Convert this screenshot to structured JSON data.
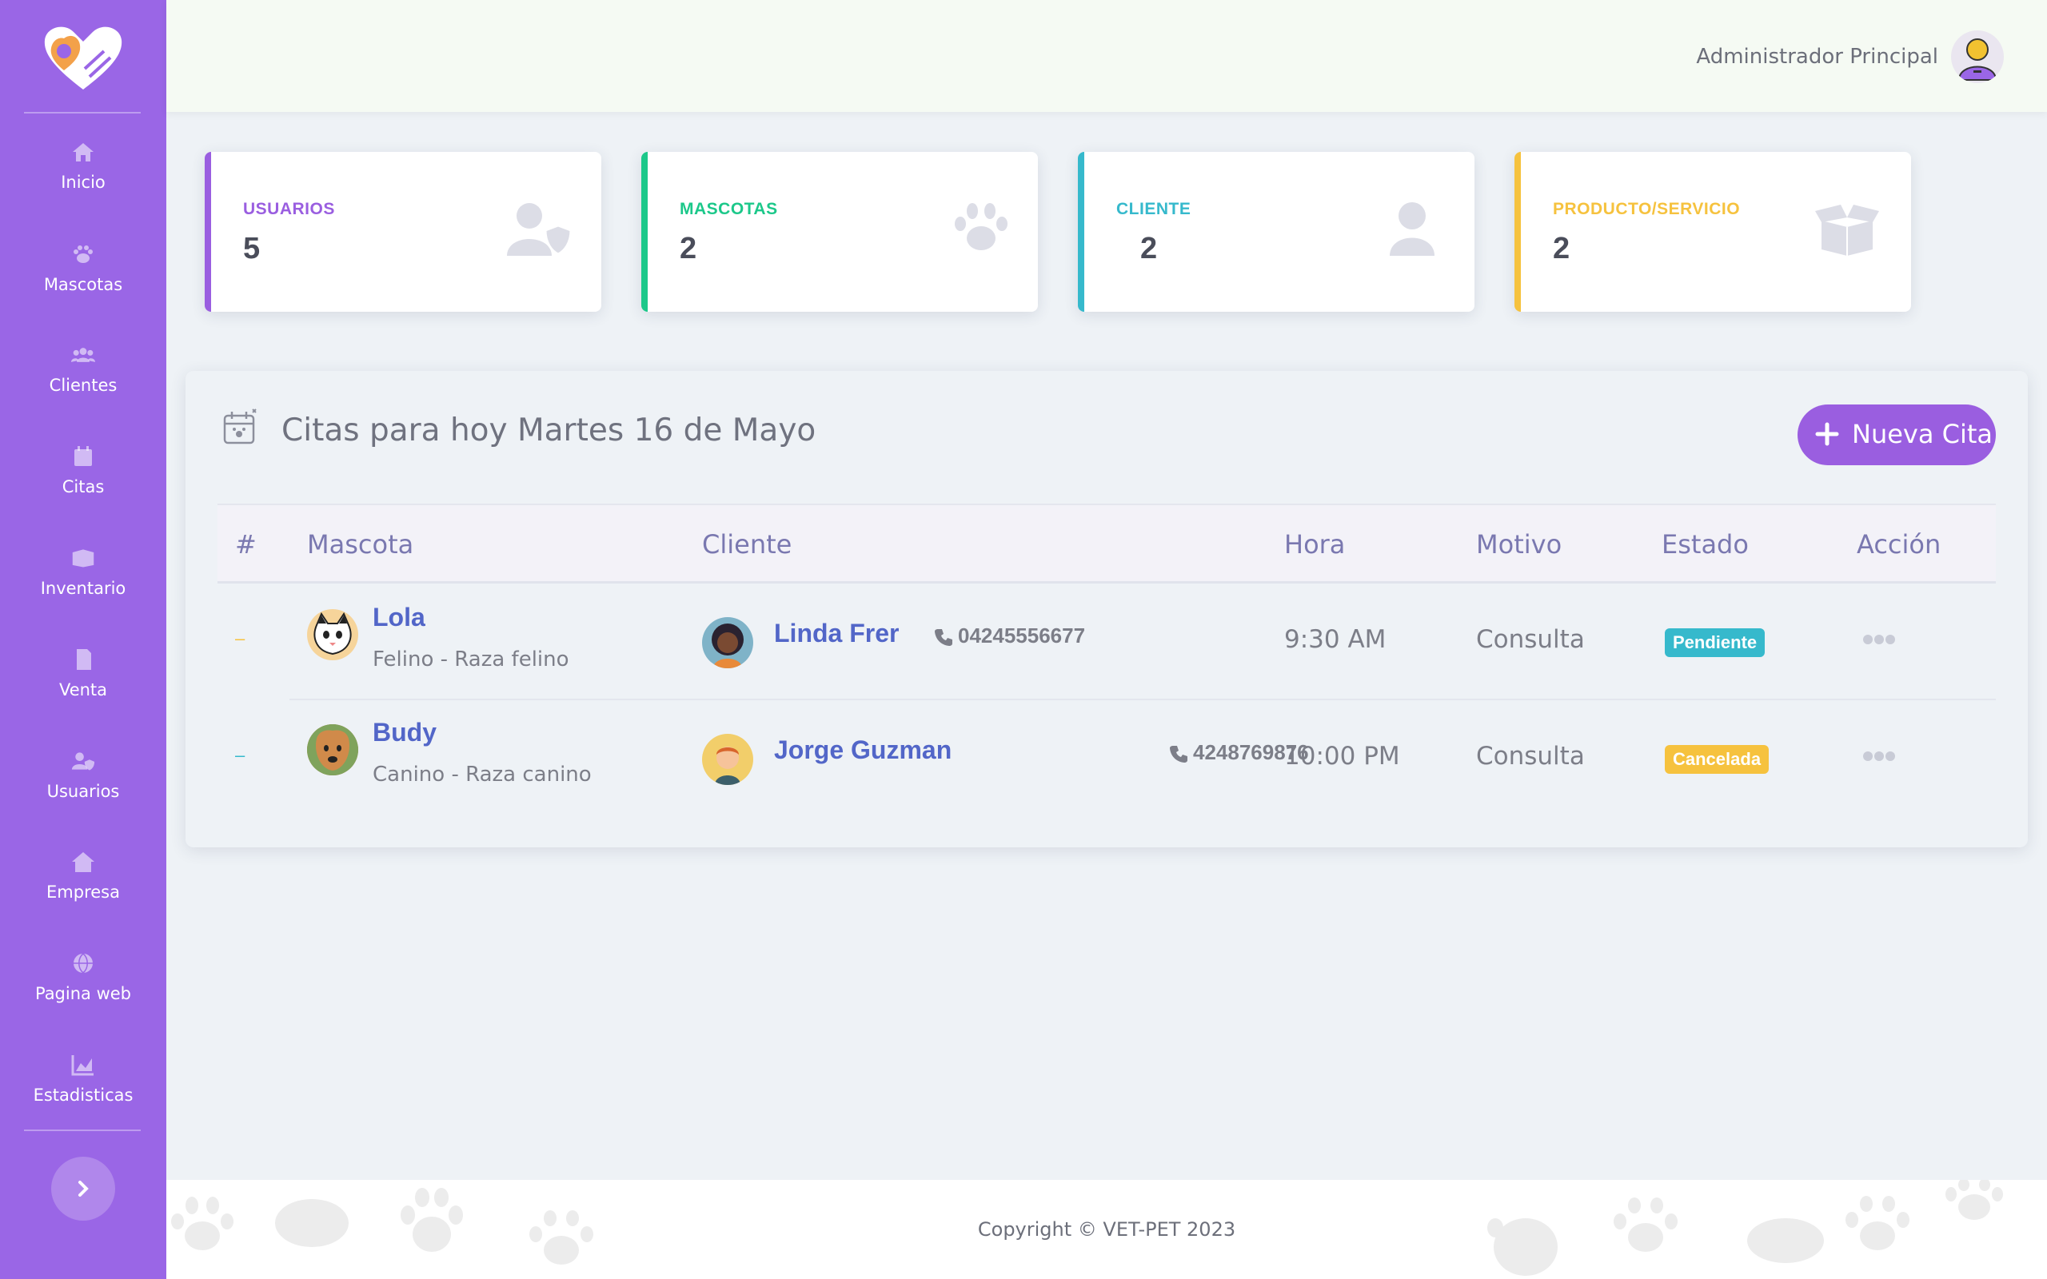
{
  "sidebar": {
    "items": [
      {
        "label": "Inicio",
        "icon": "home-icon"
      },
      {
        "label": "Mascotas",
        "icon": "paw-icon"
      },
      {
        "label": "Clientes",
        "icon": "users-icon"
      },
      {
        "label": "Citas",
        "icon": "calendar-icon"
      },
      {
        "label": "Inventario",
        "icon": "box-icon"
      },
      {
        "label": "Venta",
        "icon": "receipt-icon"
      },
      {
        "label": "Usuarios",
        "icon": "user-shield-icon"
      },
      {
        "label": "Empresa",
        "icon": "house-icon"
      },
      {
        "label": "Pagina web",
        "icon": "globe-icon"
      },
      {
        "label": "Estadisticas",
        "icon": "chart-icon"
      }
    ]
  },
  "header": {
    "user_name": "Administrador Principal"
  },
  "stats": [
    {
      "title": "USUARIOS",
      "value": "5",
      "color": "#9a5ee0",
      "icon": "user-shield-icon"
    },
    {
      "title": "MASCOTAS",
      "value": "2",
      "color": "#1cc88a",
      "icon": "paw-icon"
    },
    {
      "title": "CLIENTE",
      "value": "2",
      "color": "#36b9cc",
      "icon": "user-icon"
    },
    {
      "title": "PRODUCTO/SERVICIO",
      "value": "2",
      "color": "#f6c23e",
      "icon": "box-open-icon"
    }
  ],
  "appointments": {
    "title": "Citas para hoy Martes 16 de Mayo",
    "new_button": "Nueva Cita",
    "columns": [
      "#",
      "Mascota",
      "Cliente",
      "Hora",
      "Motivo",
      "Estado",
      "Acción"
    ],
    "rows": [
      {
        "index": "–",
        "pet": "Lola",
        "pet_detail": "Felino - Raza felino",
        "client": "Linda Frer",
        "phone": "04245556677",
        "time": "9:30 AM",
        "reason": "Consulta",
        "status": "Pendiente",
        "status_color": "#36b9cc"
      },
      {
        "index": "–",
        "pet": "Budy",
        "pet_detail": "Canino - Raza canino",
        "client": "Jorge Guzman",
        "phone": "4248769876",
        "time": "10:00 PM",
        "reason": "Consulta",
        "status": "Cancelada",
        "status_color": "#f6c23e"
      }
    ]
  },
  "footer": {
    "copyright": "Copyright © VET-PET 2023"
  },
  "colors": {
    "sidebar": "#9a66e6",
    "accent": "#9a5ee0",
    "link": "#5266c8"
  }
}
